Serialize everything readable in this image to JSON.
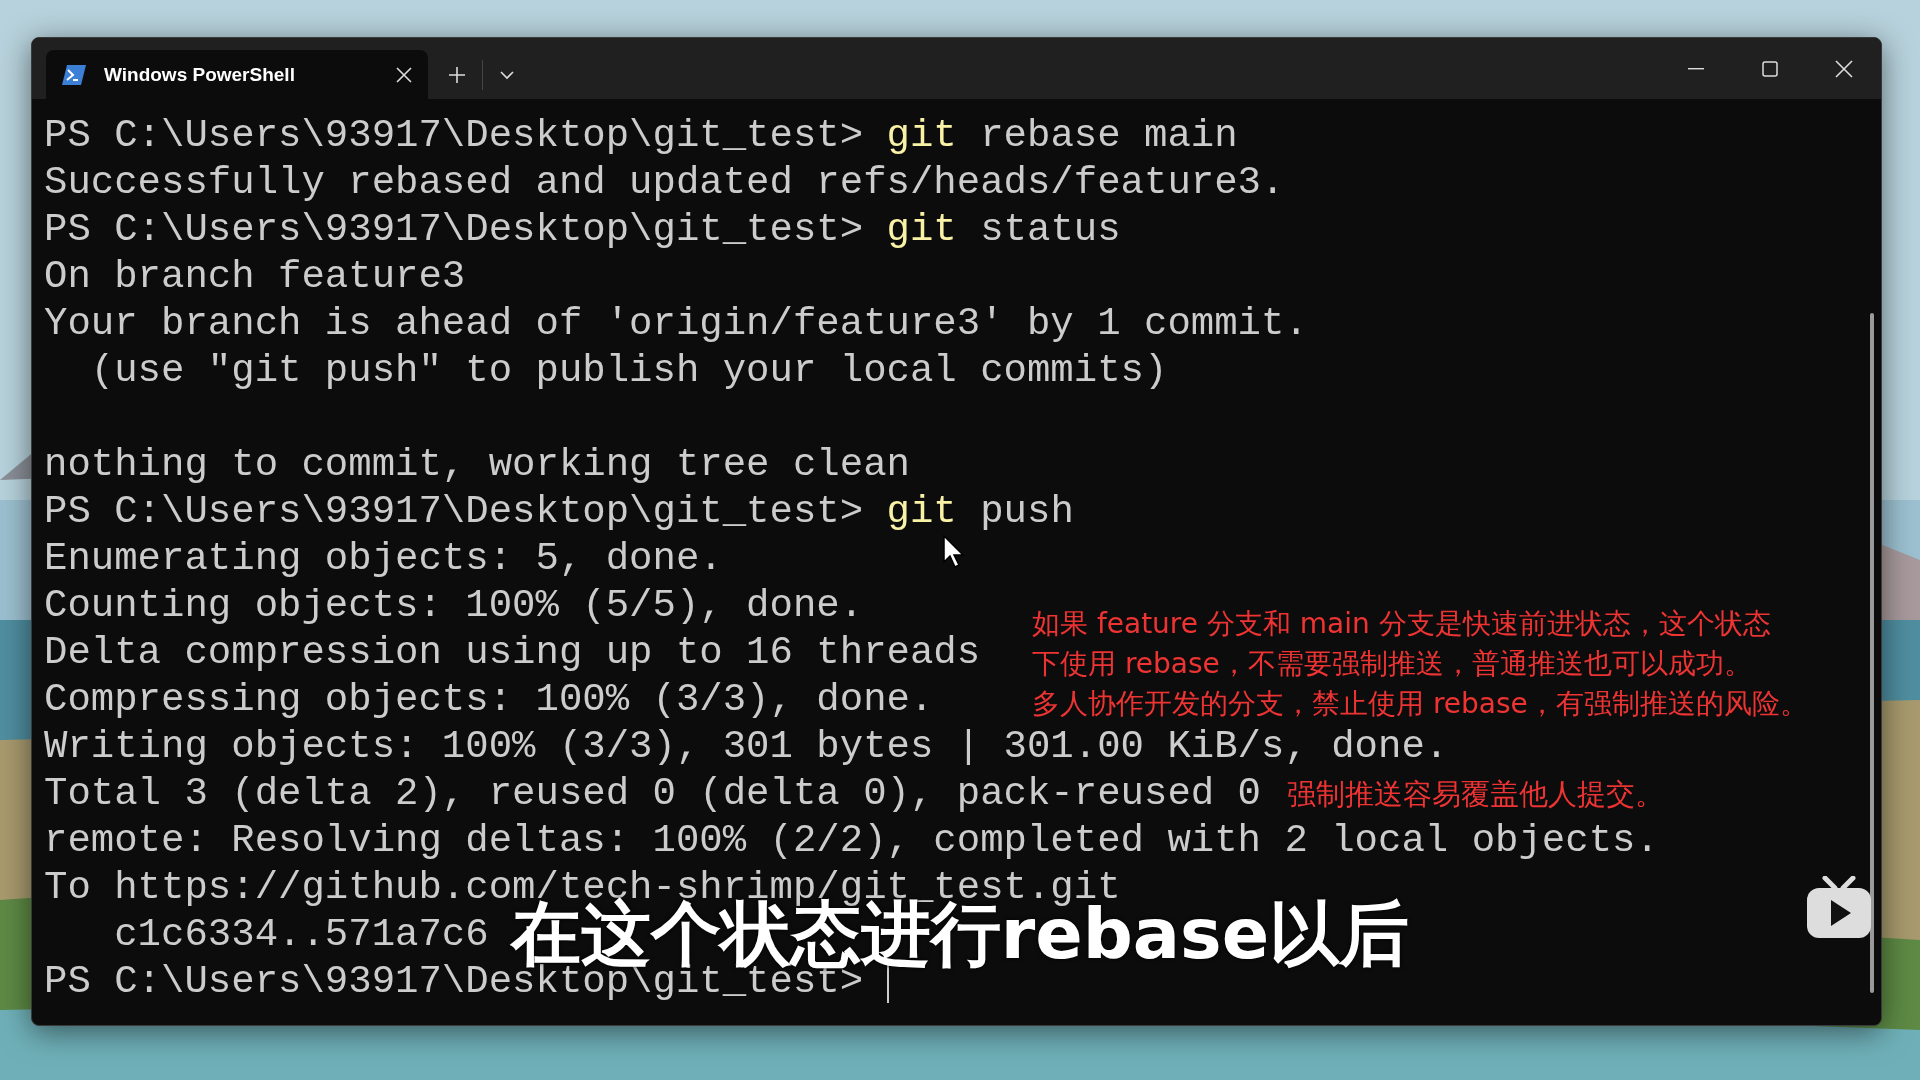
{
  "window": {
    "tab_title": "Windows PowerShell"
  },
  "lines": [
    {
      "kind": "prompt",
      "prompt": "PS C:\\Users\\93917\\Desktop\\git_test>",
      "command": "git",
      "args": "rebase main"
    },
    {
      "kind": "output",
      "text": "Successfully rebased and updated refs/heads/feature3."
    },
    {
      "kind": "prompt",
      "prompt": "PS C:\\Users\\93917\\Desktop\\git_test>",
      "command": "git",
      "args": "status"
    },
    {
      "kind": "output",
      "text": "On branch feature3"
    },
    {
      "kind": "output",
      "text": "Your branch is ahead of 'origin/feature3' by 1 commit."
    },
    {
      "kind": "output",
      "text": "  (use \"git push\" to publish your local commits)"
    },
    {
      "kind": "blank"
    },
    {
      "kind": "output",
      "text": "nothing to commit, working tree clean"
    },
    {
      "kind": "prompt",
      "prompt": "PS C:\\Users\\93917\\Desktop\\git_test>",
      "command": "git",
      "args": "push"
    },
    {
      "kind": "output",
      "text": "Enumerating objects: 5, done."
    },
    {
      "kind": "output",
      "text": "Counting objects: 100% (5/5), done."
    },
    {
      "kind": "output",
      "text": "Delta compression using up to 16 threads"
    },
    {
      "kind": "output",
      "text": "Compressing objects: 100% (3/3), done."
    },
    {
      "kind": "output",
      "text": "Writing objects: 100% (3/3), 301 bytes | 301.00 KiB/s, done."
    },
    {
      "kind": "output",
      "text": "Total 3 (delta 2), reused 0 (delta 0), pack-reused 0",
      "note": "强制推送容易覆盖他人提交。"
    },
    {
      "kind": "output",
      "text": "remote: Resolving deltas: 100% (2/2), completed with 2 local objects."
    },
    {
      "kind": "output",
      "text": "To https://github.com/tech-shrimp/git_test.git"
    },
    {
      "kind": "output",
      "text": "   c1c6334..571a7c6"
    },
    {
      "kind": "prompt",
      "prompt": "PS C:\\Users\\93917\\Desktop\\git_test>",
      "cursor": true
    }
  ],
  "annotation": [
    "如果 feature 分支和 main 分支是快速前进状态，这个状态",
    "下使用 rebase，不需要强制推送，普通推送也可以成功。",
    "多人协作开发的分支，禁止使用 rebase，有强制推送的风险。"
  ],
  "subtitle": "在这个状态进行rebase以后"
}
